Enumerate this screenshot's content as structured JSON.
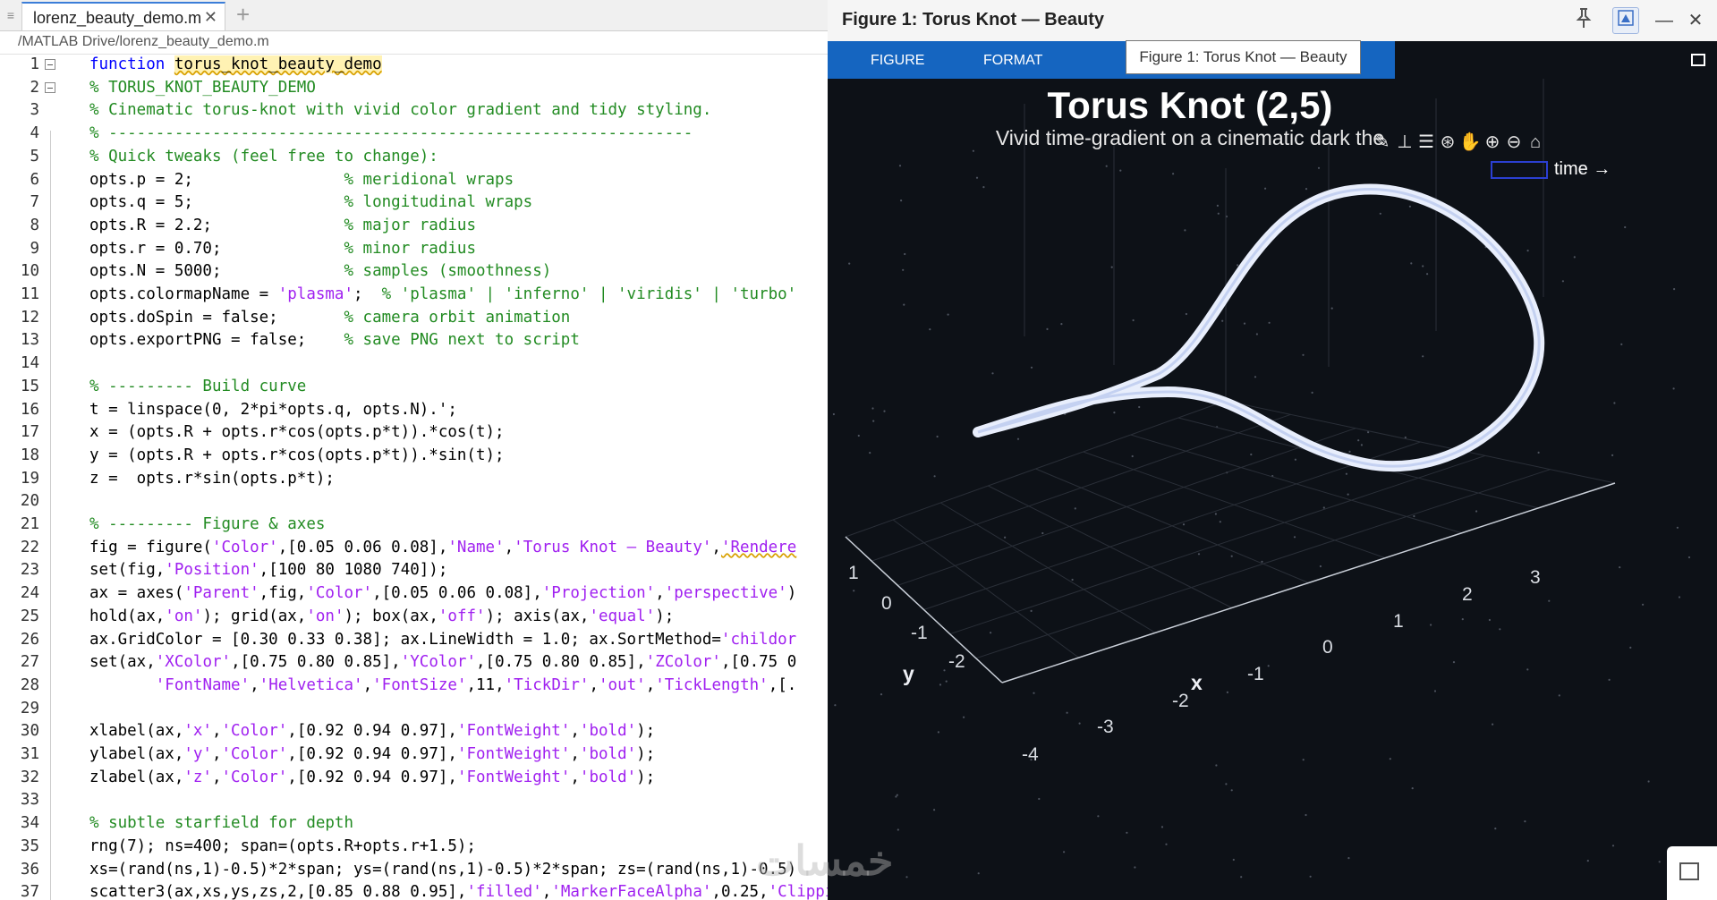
{
  "editor": {
    "tab_menu_icon": "≡",
    "tab_title": "lorenz_beauty_demo.m",
    "tab_close": "✕",
    "tab_add": "+",
    "path": "/MATLAB Drive/lorenz_beauty_demo.m"
  },
  "code_lines": [
    "1",
    "2",
    "3",
    "4",
    "5",
    "6",
    "7",
    "8",
    "9",
    "10",
    "11",
    "12",
    "13",
    "14",
    "15",
    "16",
    "17",
    "18",
    "19",
    "20",
    "21",
    "22",
    "23",
    "24",
    "25",
    "26",
    "27",
    "28",
    "29",
    "30",
    "31",
    "32",
    "33",
    "34",
    "35",
    "36",
    "37"
  ],
  "code": {
    "l1_kw": "function",
    "l1_fn": "torus_knot_beauty_demo",
    "l2": "% TORUS_KNOT_BEAUTY_DEMO",
    "l3": "% Cinematic torus-knot with vivid color gradient and tidy styling.",
    "l4": "% --------------------------------------------------------------",
    "l5": "% Quick tweaks (feel free to change):",
    "l6_code": "opts.p = 2;                ",
    "l6_cm": "% meridional wraps",
    "l7_code": "opts.q = 5;                ",
    "l7_cm": "% longitudinal wraps",
    "l8_code": "opts.R = 2.2;              ",
    "l8_cm": "% major radius",
    "l9_code": "opts.r = 0.70;             ",
    "l9_cm": "% minor radius",
    "l10_code": "opts.N = 5000;             ",
    "l10_cm": "% samples (smoothness)",
    "l11_a": "opts.colormapName = ",
    "l11_str": "'plasma'",
    "l11_b": ";  ",
    "l11_cm": "% 'plasma' | 'inferno' | 'viridis' | 'turbo'",
    "l12_code": "opts.doSpin = false;       ",
    "l12_cm": "% camera orbit animation",
    "l13_code": "opts.exportPNG = false;    ",
    "l13_cm": "% save PNG next to script",
    "l15": "% --------- Build curve",
    "l16": "t = linspace(0, 2*pi*opts.q, opts.N).';",
    "l17": "x = (opts.R + opts.r*cos(opts.p*t)).*cos(t);",
    "l18": "y = (opts.R + opts.r*cos(opts.p*t)).*sin(t);",
    "l19": "z =  opts.r*sin(opts.p*t);",
    "l21": "% --------- Figure & axes",
    "l22_a": "fig = figure(",
    "l22_s1": "'Color'",
    "l22_b": ",[0.05 0.06 0.08],",
    "l22_s2": "'Name'",
    "l22_c": ",",
    "l22_s3": "'Torus Knot — Beauty'",
    "l22_d": ",",
    "l22_s4": "'Rendere",
    "l23_a": "set(fig,",
    "l23_s1": "'Position'",
    "l23_b": ",[100 80 1080 740]);",
    "l24_a": "ax = axes(",
    "l24_s1": "'Parent'",
    "l24_b": ",fig,",
    "l24_s2": "'Color'",
    "l24_c": ",[0.05 0.06 0.08],",
    "l24_s3": "'Projection'",
    "l24_d": ",",
    "l24_s4": "'perspective'",
    "l24_e": ")",
    "l25_a": "hold(ax,",
    "l25_s1": "'on'",
    "l25_b": "); grid(ax,",
    "l25_s2": "'on'",
    "l25_c": "); box(ax,",
    "l25_s3": "'off'",
    "l25_d": "); axis(ax,",
    "l25_s4": "'equal'",
    "l25_e": ");",
    "l26_a": "ax.GridColor = [0.30 0.33 0.38]; ax.LineWidth = 1.0; ax.SortMethod=",
    "l26_s1": "'childor",
    "l27_a": "set(ax,",
    "l27_s1": "'XColor'",
    "l27_b": ",[0.75 0.80 0.85],",
    "l27_s2": "'YColor'",
    "l27_c": ",[0.75 0.80 0.85],",
    "l27_s3": "'ZColor'",
    "l27_d": ",[0.75 0",
    "l28_a": "       ",
    "l28_s1": "'FontName'",
    "l28_b": ",",
    "l28_s2": "'Helvetica'",
    "l28_c": ",",
    "l28_s3": "'FontSize'",
    "l28_d": ",11,",
    "l28_s4": "'TickDir'",
    "l28_e": ",",
    "l28_s5": "'out'",
    "l28_f": ",",
    "l28_s6": "'TickLength'",
    "l28_g": ",[.",
    "l30_a": "xlabel(ax,",
    "l30_s1": "'x'",
    "l30_b": ",",
    "l30_s2": "'Color'",
    "l30_c": ",[0.92 0.94 0.97],",
    "l30_s3": "'FontWeight'",
    "l30_d": ",",
    "l30_s4": "'bold'",
    "l30_e": ");",
    "l31_a": "ylabel(ax,",
    "l31_s1": "'y'",
    "l32_a": "zlabel(ax,",
    "l32_s1": "'z'",
    "l34": "% subtle starfield for depth",
    "l35": "rng(7); ns=400; span=(opts.R+opts.r+1.5);",
    "l36": "xs=(rand(ns,1)-0.5)*2*span; ys=(rand(ns,1)-0.5)*2*span; zs=(rand(ns,1)-0.5)",
    "l37_a": "scatter3(ax,xs,ys,zs,2,[0.85 0.88 0.95],",
    "l37_s1": "'filled'",
    "l37_b": ",",
    "l37_s2": "'MarkerFaceAlpha'",
    "l37_c": ",0.25,",
    "l37_s3": "'Clipping'"
  },
  "figure": {
    "title": "Figure 1: Torus Knot — Beauty",
    "ctrl_pin": "pin-icon",
    "ctrl_undock": "undock-icon",
    "ctrl_minimize": "—",
    "ctrl_close": "✕",
    "strip_tabs": [
      "FIGURE",
      "FORMAT"
    ],
    "tooltip": "Figure 1: Torus Knot — Beauty",
    "plot_title": "Torus Knot (2,5)",
    "plot_subtitle": "Vivid time-gradient on a cinematic dark the",
    "legend_label": "time →",
    "axes_toolbar": [
      "brush-icon",
      "data-tips-icon",
      "link-icon",
      "rotate-icon",
      "pan-icon",
      "zoom-in-icon",
      "zoom-out-icon",
      "home-icon"
    ],
    "x_ticks": [
      "-4",
      "-3",
      "-2",
      "-1",
      "0",
      "1",
      "2",
      "3"
    ],
    "y_ticks": [
      "-2",
      "-1",
      "0",
      "1"
    ],
    "x_label": "x",
    "y_label": "y",
    "curve_color": "#e8eefc",
    "legend_color": "#2b3fd1",
    "toolstrip_color": "#1565c0",
    "background": "#0d1117"
  },
  "watermark": "خمسات"
}
